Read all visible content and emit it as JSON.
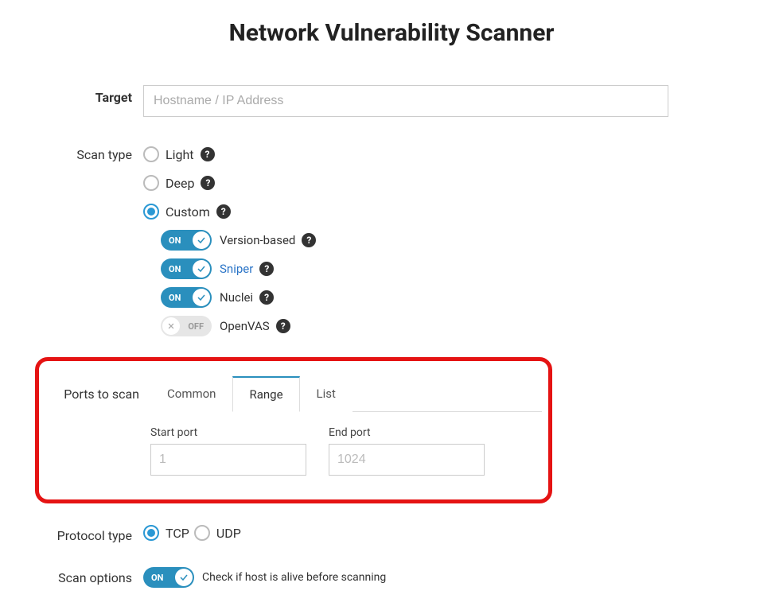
{
  "title": "Network Vulnerability Scanner",
  "target": {
    "label": "Target",
    "placeholder": "Hostname / IP Address",
    "value": ""
  },
  "scan_type": {
    "label": "Scan type",
    "options": {
      "light": "Light",
      "deep": "Deep",
      "custom": "Custom"
    },
    "toggles": {
      "on_label": "ON",
      "off_label": "OFF",
      "version_based": "Version-based",
      "sniper": "Sniper",
      "nuclei": "Nuclei",
      "openvas": "OpenVAS"
    }
  },
  "ports": {
    "label": "Ports to scan",
    "tabs": {
      "common": "Common",
      "range": "Range",
      "list": "List"
    },
    "start_label": "Start port",
    "start_placeholder": "1",
    "end_label": "End port",
    "end_placeholder": "1024"
  },
  "protocol": {
    "label": "Protocol type",
    "tcp": "TCP",
    "udp": "UDP"
  },
  "scan_options": {
    "label": "Scan options",
    "on_label": "ON",
    "check_alive": "Check if host is alive before scanning"
  }
}
